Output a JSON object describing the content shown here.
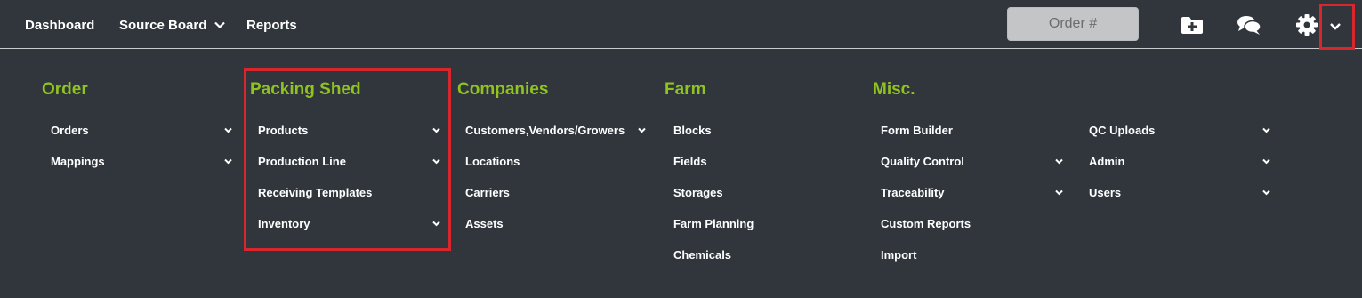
{
  "topnav": {
    "dashboard": "Dashboard",
    "source_board": "Source Board",
    "reports": "Reports"
  },
  "search": {
    "placeholder": "Order #"
  },
  "icons": {
    "new_folder": "folder-plus-icon",
    "chat": "chat-bubbles-icon",
    "settings": "gear-icon",
    "expand": "chevron-down-icon"
  },
  "colors": {
    "background": "#30363c",
    "heading": "#8fc31f",
    "highlight": "#d7262c",
    "input_bg": "#c3c5c6"
  },
  "menu": {
    "order": {
      "title": "Order",
      "items": [
        {
          "label": "Orders",
          "has_submenu": true
        },
        {
          "label": "Mappings",
          "has_submenu": true
        }
      ]
    },
    "packing_shed": {
      "title": "Packing Shed",
      "items": [
        {
          "label": "Products",
          "has_submenu": true
        },
        {
          "label": "Production Line",
          "has_submenu": true
        },
        {
          "label": "Receiving Templates",
          "has_submenu": false
        },
        {
          "label": "Inventory",
          "has_submenu": true
        }
      ]
    },
    "companies": {
      "title": "Companies",
      "items": [
        {
          "label": "Customers,Vendors/Growers",
          "has_submenu": true
        },
        {
          "label": "Locations",
          "has_submenu": false
        },
        {
          "label": "Carriers",
          "has_submenu": false
        },
        {
          "label": "Assets",
          "has_submenu": false
        }
      ]
    },
    "farm": {
      "title": "Farm",
      "items": [
        {
          "label": "Blocks",
          "has_submenu": false
        },
        {
          "label": "Fields",
          "has_submenu": false
        },
        {
          "label": "Storages",
          "has_submenu": false
        },
        {
          "label": "Farm Planning",
          "has_submenu": false
        },
        {
          "label": "Chemicals",
          "has_submenu": false
        }
      ]
    },
    "misc": {
      "title": "Misc.",
      "items": [
        {
          "label": "Form Builder",
          "has_submenu": false
        },
        {
          "label": "Quality Control",
          "has_submenu": true
        },
        {
          "label": "Traceability",
          "has_submenu": true
        },
        {
          "label": "Custom Reports",
          "has_submenu": false
        },
        {
          "label": "Import",
          "has_submenu": false
        }
      ]
    },
    "misc2": {
      "items": [
        {
          "label": "QC Uploads",
          "has_submenu": true
        },
        {
          "label": "Admin",
          "has_submenu": true
        },
        {
          "label": "Users",
          "has_submenu": true
        }
      ]
    }
  }
}
